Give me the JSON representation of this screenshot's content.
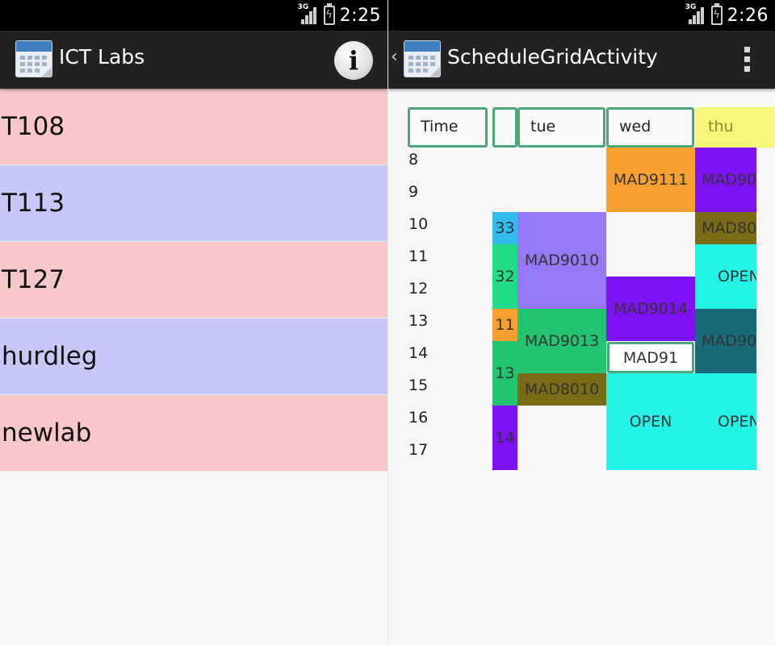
{
  "left": {
    "status": {
      "clock": "2:25",
      "network": "3G"
    },
    "title": "ICT Labs",
    "labs": [
      {
        "name": "T108",
        "color": "#f8c8c8"
      },
      {
        "name": "T113",
        "color": "#c8c8f8"
      },
      {
        "name": "T127",
        "color": "#f8c8c8"
      },
      {
        "name": "hurdleg",
        "color": "#c8c8f8"
      },
      {
        "name": "newlab",
        "color": "#f8c8c8"
      }
    ]
  },
  "right": {
    "status": {
      "clock": "2:26",
      "network": "3G"
    },
    "title": "ScheduleGridActivity",
    "headers": {
      "time": "Time",
      "mon": "",
      "tue": "tue",
      "wed": "wed",
      "thu": "thu"
    },
    "hours": [
      "8",
      "9",
      "10",
      "11",
      "12",
      "13",
      "14",
      "15",
      "16",
      "17"
    ],
    "blocks": {
      "mon_a": {
        "label": "33",
        "color": "#33bbee"
      },
      "mon_b": {
        "label": "32",
        "color": "#22dd88"
      },
      "mon_c": {
        "label": "11",
        "color": "#f7a030"
      },
      "mon_d": {
        "label": "13",
        "color": "#22c472"
      },
      "mon_e": {
        "label": "14",
        "color": "#7f12f5"
      },
      "tue_a": {
        "label": "MAD9010",
        "color": "#9679f7"
      },
      "tue_b": {
        "label": "MAD9013",
        "color": "#22c472"
      },
      "tue_c": {
        "label": "MAD8010",
        "color": "#7a6c15"
      },
      "wed_a": {
        "label": "MAD9111",
        "color": "#f7a030"
      },
      "wed_b": {
        "label": "MAD9014",
        "color": "#7f12f5"
      },
      "wed_c": {
        "label": "MAD91",
        "color": "#ffffff"
      },
      "wed_d": {
        "label": "OPEN",
        "color": "#22f5e5"
      },
      "thu_a": {
        "label": "MAD90",
        "color": "#7f12f5"
      },
      "thu_b": {
        "label": "MAD80",
        "color": "#7a6c15"
      },
      "thu_c": {
        "label": "OPEN",
        "color": "#22f5e5"
      },
      "thu_d": {
        "label": "MAD90",
        "color": "#186b78"
      },
      "thu_e": {
        "label": "OPEN",
        "color": "#22f5e5"
      }
    },
    "colors": {
      "header_border": "#4aa77a",
      "thu_header_bg": "#f5f77a",
      "thu_header_text": "#8a8f2a"
    }
  }
}
